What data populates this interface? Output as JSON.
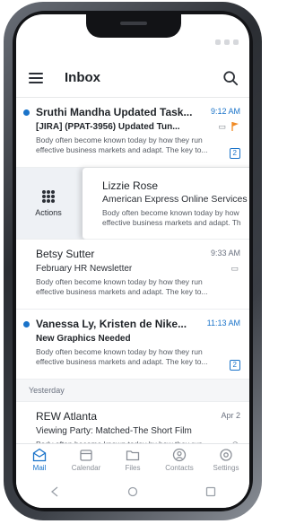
{
  "app": {
    "title": "Inbox"
  },
  "messages_top": [
    {
      "sender": "Sruthi Mandha Updated Task...",
      "time": "9:12 AM",
      "subject": "[JIRA] (PPAT-3956) Updated Tun...",
      "preview": "Body often become known today by how they run effective business markets and adapt. The key to...",
      "count": "2",
      "unread": true
    }
  ],
  "swiped_message": {
    "action_label": "Actions",
    "sender": "Lizzie Rose",
    "subject": "American Express Online Services",
    "preview_line1": "Body often become known today by how",
    "preview_line2": "effective business markets and adapt. Th"
  },
  "messages_mid": [
    {
      "sender": "Betsy Sutter",
      "time": "9:33 AM",
      "subject": "February HR Newsletter",
      "preview": "Body often become known today by how they run effective business markets and adapt. The key to...",
      "unread": false
    },
    {
      "sender": "Vanessa Ly, Kristen de Nike...",
      "time": "11:13 AM",
      "subject": "New Graphics Needed",
      "preview": "Body often become known today by how they run effective business markets and adapt. The key to...",
      "count": "2",
      "unread": true
    }
  ],
  "section": {
    "yesterday_label": "Yesterday"
  },
  "messages_yesterday": [
    {
      "sender": "REW Atlanta",
      "time": "Apr 2",
      "subject": "Viewing Party: Matched-The Short Film",
      "preview": "Body often become known today by how they run effective business markets and adapt. The key to...",
      "unread": false
    }
  ],
  "bottom_nav": {
    "items": [
      {
        "label": "Mail",
        "icon": "mail-icon",
        "active": true
      },
      {
        "label": "Calendar",
        "icon": "calendar-icon",
        "active": false
      },
      {
        "label": "Files",
        "icon": "folder-icon",
        "active": false
      },
      {
        "label": "Contacts",
        "icon": "contacts-icon",
        "active": false
      },
      {
        "label": "Settings",
        "icon": "settings-icon",
        "active": false
      }
    ]
  },
  "colors": {
    "accent": "#1a73c9",
    "flag": "#f08a24"
  }
}
